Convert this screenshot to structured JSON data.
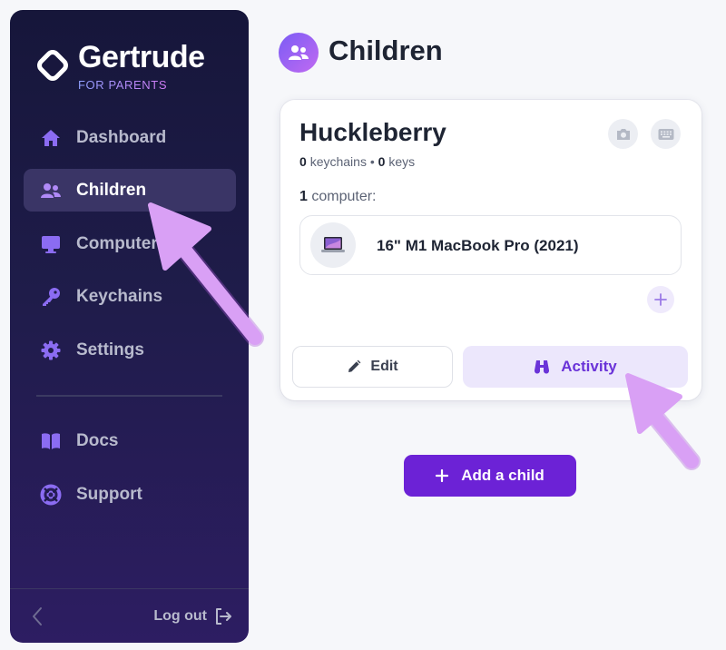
{
  "brand": {
    "name": "Gertrude",
    "subtitle": "FOR PARENTS"
  },
  "sidebar": {
    "items": [
      {
        "label": "Dashboard",
        "icon": "home-icon"
      },
      {
        "label": "Children",
        "icon": "users-icon",
        "active": true
      },
      {
        "label": "Computers",
        "icon": "desktop-icon"
      },
      {
        "label": "Keychains",
        "icon": "key-icon"
      },
      {
        "label": "Settings",
        "icon": "gear-icon"
      }
    ],
    "secondary_items": [
      {
        "label": "Docs",
        "icon": "book-icon"
      },
      {
        "label": "Support",
        "icon": "lifebuoy-icon"
      }
    ],
    "logout_label": "Log out"
  },
  "page": {
    "title": "Children"
  },
  "child_card": {
    "name": "Huckleberry",
    "keychains_count": "0",
    "keychains_label": "keychains",
    "separator": "•",
    "keys_count": "0",
    "keys_label": "keys",
    "computers_count": "1",
    "computers_label": "computer:",
    "computers": [
      {
        "name": "16\" M1 MacBook Pro (2021)"
      }
    ],
    "edit_label": "Edit",
    "activity_label": "Activity"
  },
  "add_child_label": "Add a child",
  "colors": {
    "accent": "#6c22d6",
    "arrow": "#d9a0f5",
    "sidebar_bg": "#1f1c4a"
  }
}
